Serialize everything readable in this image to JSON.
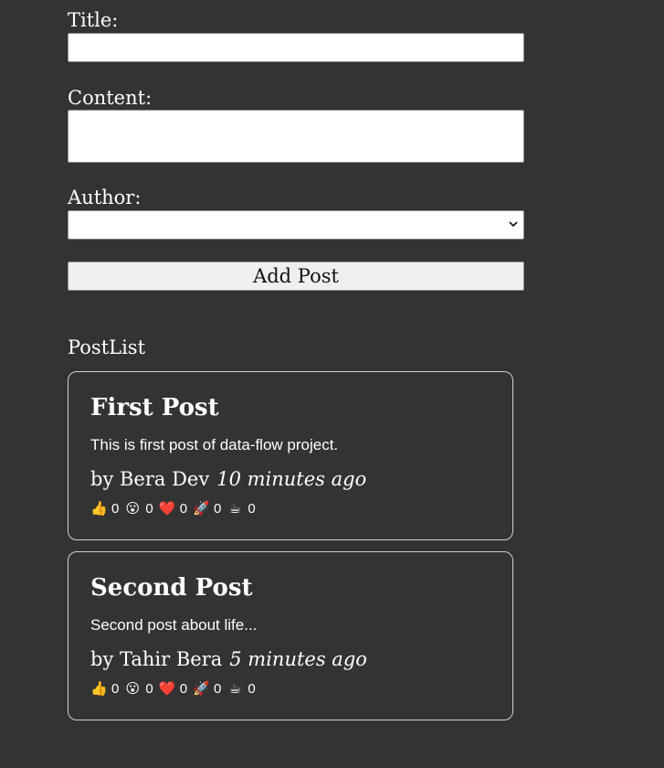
{
  "form": {
    "title_label": "Title:",
    "content_label": "Content:",
    "author_label": "Author:",
    "title_value": "",
    "content_value": "",
    "author_value": "",
    "add_button_label": "Add Post"
  },
  "post_list": {
    "heading": "PostList",
    "posts": [
      {
        "title": "First Post",
        "content": "This is first post of data-flow project.",
        "author": "by Bera Dev",
        "time": "10 minutes ago",
        "reactions": [
          {
            "icon": "thumbs-up-icon",
            "emoji": "👍",
            "count": "0"
          },
          {
            "icon": "surprised-face-icon",
            "emoji": "😮",
            "count": "0"
          },
          {
            "icon": "heart-icon",
            "emoji": "❤️",
            "count": "0"
          },
          {
            "icon": "rocket-icon",
            "emoji": "🚀",
            "count": "0"
          },
          {
            "icon": "coffee-icon",
            "emoji": "☕",
            "count": "0"
          }
        ]
      },
      {
        "title": "Second Post",
        "content": "Second post about life...",
        "author": "by Tahir Bera",
        "time": "5 minutes ago",
        "reactions": [
          {
            "icon": "thumbs-up-icon",
            "emoji": "👍",
            "count": "0"
          },
          {
            "icon": "surprised-face-icon",
            "emoji": "😮",
            "count": "0"
          },
          {
            "icon": "heart-icon",
            "emoji": "❤️",
            "count": "0"
          },
          {
            "icon": "rocket-icon",
            "emoji": "🚀",
            "count": "0"
          },
          {
            "icon": "coffee-icon",
            "emoji": "☕",
            "count": "0"
          }
        ]
      }
    ]
  },
  "colors": {
    "background": "#333333",
    "text": "#ffffff",
    "card_border": "#cfcfcf",
    "button_background": "#efefef"
  }
}
